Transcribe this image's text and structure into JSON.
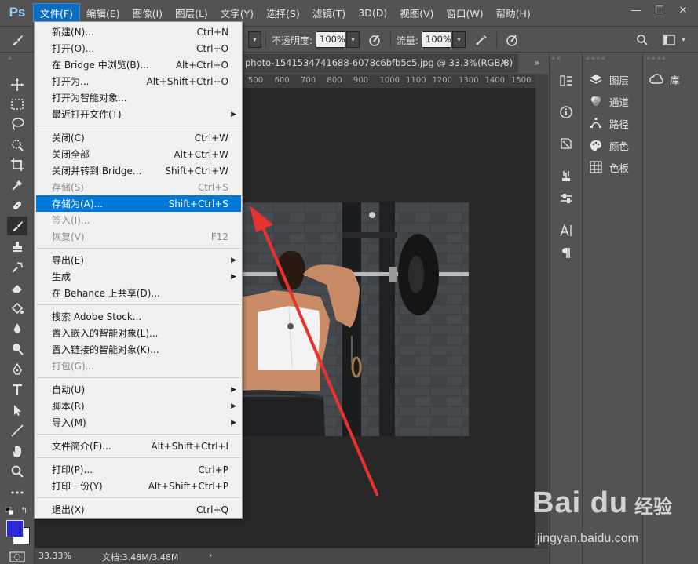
{
  "app": {
    "logo": "Ps"
  },
  "menubar": {
    "items": [
      "文件(F)",
      "编辑(E)",
      "图像(I)",
      "图层(L)",
      "文字(Y)",
      "选择(S)",
      "滤镜(T)",
      "3D(D)",
      "视图(V)",
      "窗口(W)",
      "帮助(H)"
    ],
    "active_index": 0
  },
  "window_controls": {
    "minimize": "—",
    "maximize": "☐",
    "close": "✕"
  },
  "options_bar": {
    "opacity_label": "不透明度:",
    "opacity_value": "100%",
    "flow_label": "流量:",
    "flow_value": "100%"
  },
  "document": {
    "tab_title": "photo-1541534741688-6078c6bfb5c5.jpg @ 33.3%(RGB/8)",
    "close": "×",
    "ruler_ticks": [
      "500",
      "600",
      "700",
      "800",
      "900",
      "1000",
      "1100",
      "1200",
      "1300",
      "1400",
      "1500"
    ],
    "collapse": "»"
  },
  "status_bar": {
    "zoom": "33.33%",
    "doc_info": "文档:3.48M/3.48M",
    "arrow": "›"
  },
  "panels": {
    "items": [
      {
        "label": "图层",
        "icon": "layers-icon"
      },
      {
        "label": "通道",
        "icon": "channels-icon"
      },
      {
        "label": "路径",
        "icon": "paths-icon"
      },
      {
        "label": "颜色",
        "icon": "color-icon"
      },
      {
        "label": "色板",
        "icon": "swatches-icon"
      }
    ],
    "library_label": "库"
  },
  "file_menu": {
    "groups": [
      [
        {
          "label": "新建(N)...",
          "shortcut": "Ctrl+N"
        },
        {
          "label": "打开(O)...",
          "shortcut": "Ctrl+O"
        },
        {
          "label": "在 Bridge 中浏览(B)...",
          "shortcut": "Alt+Ctrl+O"
        },
        {
          "label": "打开为...",
          "shortcut": "Alt+Shift+Ctrl+O"
        },
        {
          "label": "打开为智能对象...",
          "shortcut": ""
        },
        {
          "label": "最近打开文件(T)",
          "shortcut": "",
          "submenu": true
        }
      ],
      [
        {
          "label": "关闭(C)",
          "shortcut": "Ctrl+W"
        },
        {
          "label": "关闭全部",
          "shortcut": "Alt+Ctrl+W"
        },
        {
          "label": "关闭并转到 Bridge...",
          "shortcut": "Shift+Ctrl+W"
        },
        {
          "label": "存储(S)",
          "shortcut": "Ctrl+S",
          "disabled": true
        },
        {
          "label": "存储为(A)...",
          "shortcut": "Shift+Ctrl+S",
          "highlighted": true
        },
        {
          "label": "签入(I)...",
          "shortcut": "",
          "disabled": true
        },
        {
          "label": "恢复(V)",
          "shortcut": "F12",
          "disabled": true
        }
      ],
      [
        {
          "label": "导出(E)",
          "shortcut": "",
          "submenu": true
        },
        {
          "label": "生成",
          "shortcut": "",
          "submenu": true
        },
        {
          "label": "在 Behance 上共享(D)...",
          "shortcut": ""
        }
      ],
      [
        {
          "label": "搜索 Adobe Stock...",
          "shortcut": ""
        },
        {
          "label": "置入嵌入的智能对象(L)...",
          "shortcut": ""
        },
        {
          "label": "置入链接的智能对象(K)...",
          "shortcut": ""
        },
        {
          "label": "打包(G)...",
          "shortcut": "",
          "disabled": true
        }
      ],
      [
        {
          "label": "自动(U)",
          "shortcut": "",
          "submenu": true
        },
        {
          "label": "脚本(R)",
          "shortcut": "",
          "submenu": true
        },
        {
          "label": "导入(M)",
          "shortcut": "",
          "submenu": true
        }
      ],
      [
        {
          "label": "文件简介(F)...",
          "shortcut": "Alt+Shift+Ctrl+I"
        }
      ],
      [
        {
          "label": "打印(P)...",
          "shortcut": "Ctrl+P"
        },
        {
          "label": "打印一份(Y)",
          "shortcut": "Alt+Shift+Ctrl+P"
        }
      ],
      [
        {
          "label": "退出(X)",
          "shortcut": "Ctrl+Q"
        }
      ]
    ]
  },
  "watermark": {
    "logo": "Bai du",
    "cn": "经验",
    "url": "jingyan.baidu.com"
  },
  "colors": {
    "menu_highlight": "#0078d7",
    "foreground_swatch": "#2b2bd6",
    "background_swatch": "#ffffff",
    "annotation_arrow": "#e8322f"
  }
}
